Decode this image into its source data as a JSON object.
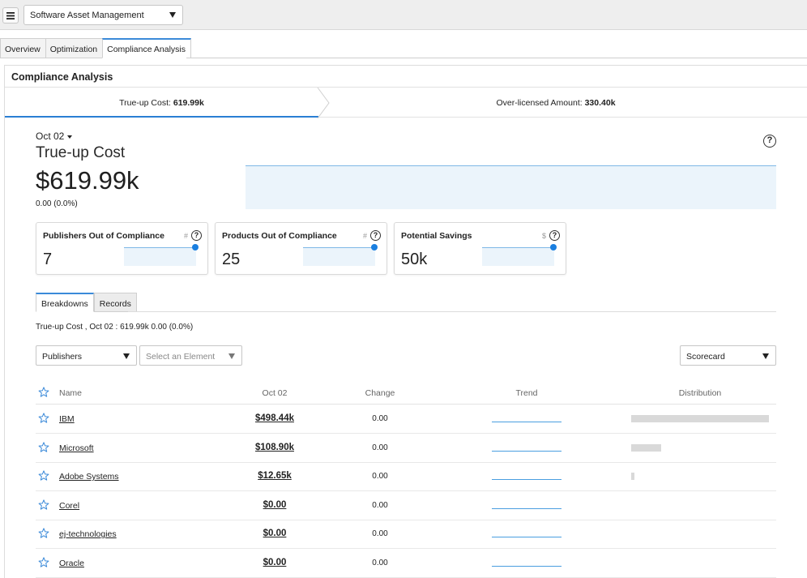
{
  "app": {
    "selector_value": "Software Asset Management"
  },
  "tabs": [
    "Overview",
    "Optimization",
    "Compliance Analysis"
  ],
  "panel": {
    "title": "Compliance Analysis",
    "steps": [
      {
        "label": "True-up Cost:",
        "value": "619.99k"
      },
      {
        "label": "Over-licensed Amount:",
        "value": "330.40k"
      }
    ]
  },
  "kpi": {
    "date": "Oct 02",
    "title": "True-up Cost",
    "value": "$619.99k",
    "change": "0.00 (0.0%)"
  },
  "cards": [
    {
      "title": "Publishers Out of Compliance",
      "unit": "#",
      "value": "7"
    },
    {
      "title": "Products Out of Compliance",
      "unit": "#",
      "value": "25"
    },
    {
      "title": "Potential Savings",
      "unit": "$",
      "value": "50k"
    }
  ],
  "subtabs": [
    "Breakdowns",
    "Records"
  ],
  "summary": "True-up Cost , Oct 02 : 619.99k 0.00 (0.0%)",
  "filters": {
    "breakdown": "Publishers",
    "element_placeholder": "Select an Element",
    "view": "Scorecard"
  },
  "table": {
    "headers": {
      "name": "Name",
      "period": "Oct 02",
      "change": "Change",
      "trend": "Trend",
      "distribution": "Distribution"
    },
    "rows": [
      {
        "name": "IBM",
        "value": "$498.44k",
        "change": "0.00",
        "distribution": 1.0
      },
      {
        "name": "Microsoft",
        "value": "$108.90k",
        "change": "0.00",
        "distribution": 0.2185
      },
      {
        "name": "Adobe Systems",
        "value": "$12.65k",
        "change": "0.00",
        "distribution": 0.0254
      },
      {
        "name": "Corel",
        "value": "$0.00",
        "change": "0.00",
        "distribution": 0
      },
      {
        "name": "ej-technologies",
        "value": "$0.00",
        "change": "0.00",
        "distribution": 0
      },
      {
        "name": "Oracle",
        "value": "$0.00",
        "change": "0.00",
        "distribution": 0
      }
    ]
  },
  "icons": {
    "menu": "hamburger-menu-icon",
    "help": "question-circle-icon",
    "star": "star-outline-icon",
    "dropdown": "caret-down-icon"
  },
  "colors": {
    "accent": "#2a7fd4",
    "spark_fill": "#ebf4fb",
    "spark_line": "#7fb8e6",
    "dot": "#1a7fe0",
    "star": "#3b8ad9",
    "bar": "#d9d9d9"
  }
}
